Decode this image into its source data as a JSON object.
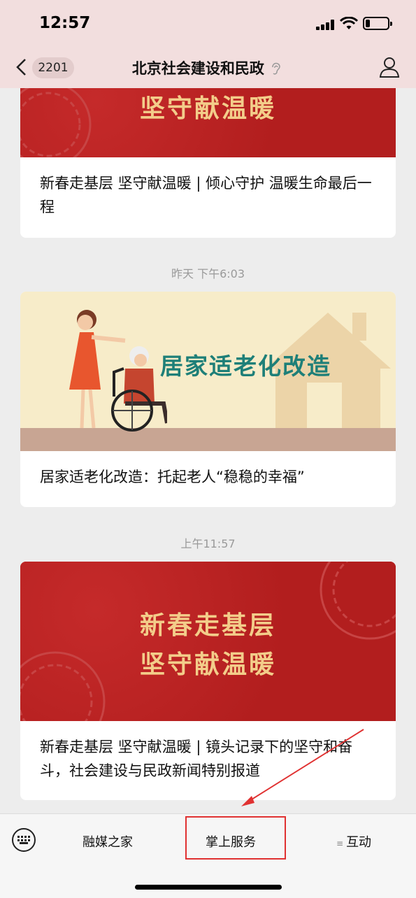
{
  "status_bar": {
    "time": "12:57"
  },
  "nav": {
    "badge": "2201",
    "title": "北京社会建设和民政",
    "icons": [
      "chevron-left-icon",
      "ear-icon",
      "person-icon"
    ]
  },
  "articles": [
    {
      "banner_text": "坚守献温暖",
      "title": "新春走基层 坚守献温暖 | 倾心守护 温暖生命最后一程"
    },
    {
      "time_label": "昨天 下午6:03",
      "banner_text": "居家适老化改造",
      "title": "居家适老化改造：托起老人“稳稳的幸福”"
    },
    {
      "time_label": "上午11:57",
      "banner_line1": "新春走基层",
      "banner_line2": "坚守献温暖",
      "title": "新春走基层 坚守献温暖 | 镜头记录下的坚守和奋斗，社会建设与民政新闻特别报道"
    }
  ],
  "bottom_menu": {
    "keyboard_icon": "keyboard-icon",
    "item1": "融媒之家",
    "item2": "掌上服务",
    "item3": "互动",
    "item3_icon": "menu-lines-icon"
  },
  "colors": {
    "banner_red": "#b21e1e",
    "banner_gold": "#f3cd8a",
    "highlight": "#e03131",
    "teal_text": "#1e7f78"
  }
}
